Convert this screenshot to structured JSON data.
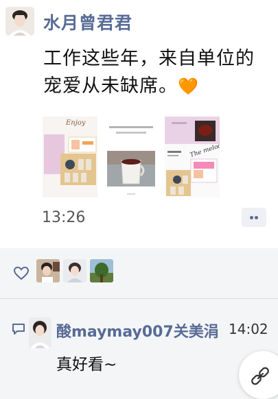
{
  "post": {
    "author": "水月曾君君",
    "text": "工作这些年，来自单位的宠爱从未缺席。",
    "heart_emoji": "🧡",
    "time": "13:26",
    "images": [
      {
        "caption": "Enjoy"
      },
      {
        "caption": ""
      },
      {
        "caption": "The melody"
      }
    ]
  },
  "likes": {
    "icon": "heart-outline-icon",
    "count": 3
  },
  "comment": {
    "icon": "comment-icon",
    "author": "酸maymay007关美涓",
    "time": "14:02",
    "text": "真好看~"
  },
  "floating_button": {
    "icon": "link-icon"
  },
  "colors": {
    "name_link": "#576b95",
    "interaction_bg": "#f4f5f7",
    "heart": "#f26b2d"
  }
}
